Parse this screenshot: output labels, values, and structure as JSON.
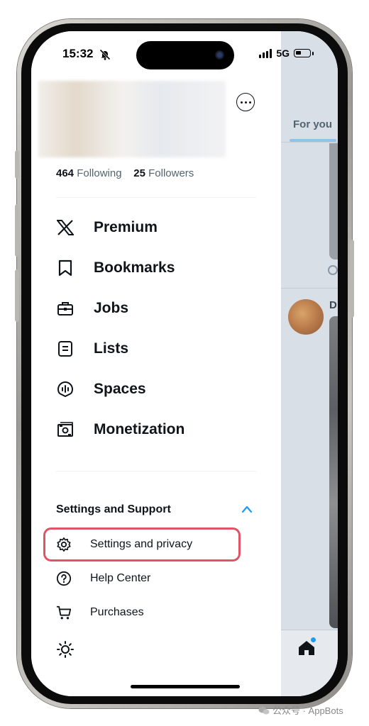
{
  "status_bar": {
    "time": "15:32",
    "network": "5G"
  },
  "profile": {
    "following_count": "464",
    "following_label": "Following",
    "followers_count": "25",
    "followers_label": "Followers"
  },
  "menu": {
    "items": [
      {
        "label": "Premium",
        "icon": "x-logo-icon"
      },
      {
        "label": "Bookmarks",
        "icon": "bookmark-icon"
      },
      {
        "label": "Jobs",
        "icon": "briefcase-icon"
      },
      {
        "label": "Lists",
        "icon": "list-icon"
      },
      {
        "label": "Spaces",
        "icon": "spaces-mic-icon"
      },
      {
        "label": "Monetization",
        "icon": "money-icon"
      }
    ]
  },
  "settings_section": {
    "title": "Settings and Support",
    "items": [
      {
        "label": "Settings and privacy",
        "icon": "gear-icon"
      },
      {
        "label": "Help Center",
        "icon": "question-circle-icon"
      },
      {
        "label": "Purchases",
        "icon": "cart-icon"
      }
    ]
  },
  "feed": {
    "tab_label": "For you",
    "author_initial": "D"
  },
  "watermark": "公众号 · AppBots",
  "colors": {
    "highlight": "#e05566",
    "accent": "#1d9bf0"
  }
}
